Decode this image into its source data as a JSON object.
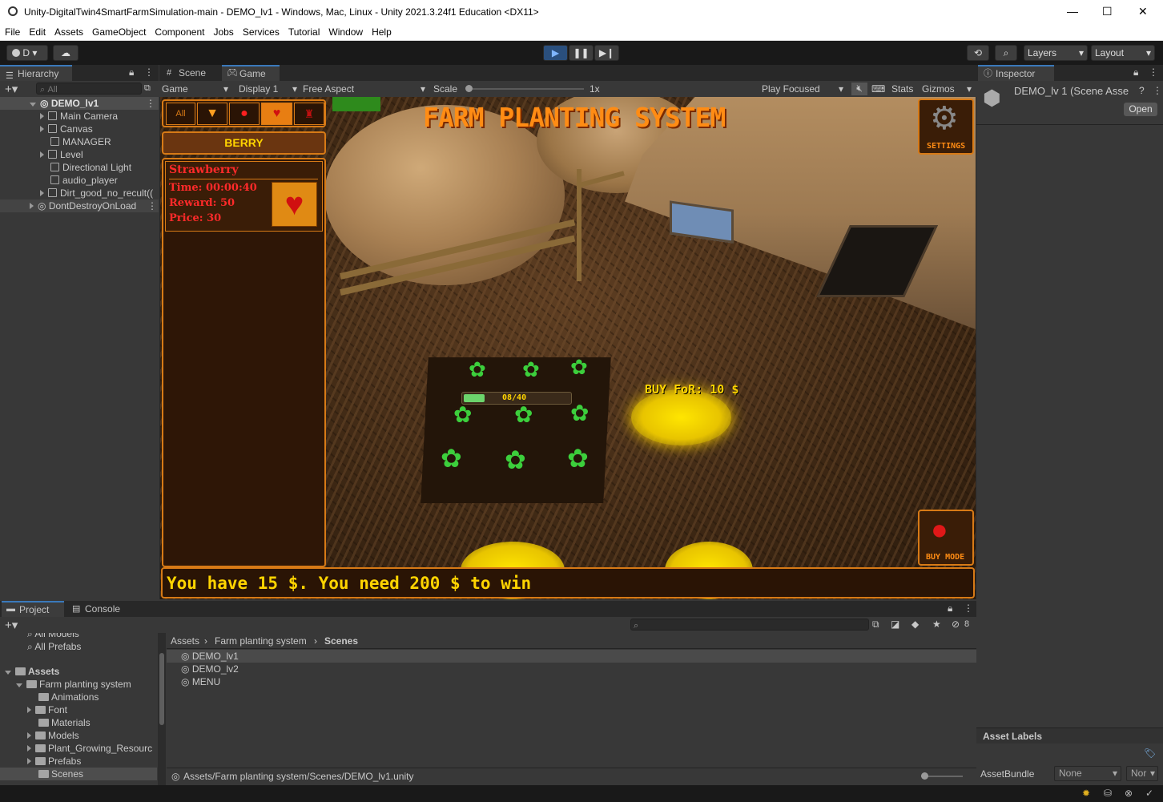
{
  "window": {
    "title": "Unity-DigitalTwin4SmartFarmSimulation-main - DEMO_lv1 - Windows, Mac, Linux - Unity 2021.3.24f1 Education <DX11>",
    "minimize": "—",
    "maximize": "☐",
    "close": "✕"
  },
  "menu": [
    "File",
    "Edit",
    "Assets",
    "GameObject",
    "Component",
    "Jobs",
    "Services",
    "Tutorial",
    "Window",
    "Help"
  ],
  "toolbar": {
    "account": "D",
    "layers": "Layers",
    "layout": "Layout"
  },
  "hierarchy": {
    "tab": "Hierarchy",
    "search_placeholder": "All",
    "scene": "DEMO_lv1",
    "items": [
      "Main Camera",
      "Canvas",
      "MANAGER",
      "Level",
      "Directional Light",
      "audio_player",
      "Dirt_good_no_recult(("
    ],
    "ddol": "DontDestroyOnLoad"
  },
  "game": {
    "tab_scene": "Scene",
    "tab_game": "Game",
    "mode": "Game",
    "display": "Display 1",
    "aspect": "Free Aspect",
    "scale_label": "Scale",
    "scale_value": "1x",
    "play_focused": "Play Focused",
    "stats": "Stats",
    "gizmos": "Gizmos"
  },
  "gameui": {
    "title": "FARM PLANTING SYSTEM",
    "filter_all": "All",
    "category": "BERRY",
    "item_name": "Strawberry",
    "item_time": "Time: 00:00:40",
    "item_reward": "Reward: 50",
    "item_price": "Price: 30",
    "settings": "SETTINGS",
    "buy_mode": "BUY MODE",
    "buy_for": "BUY FoR: 10 $",
    "progress": "08/40",
    "progress_value": 0.2,
    "message": "You have 15 $. You need 200 $ to win"
  },
  "inspector": {
    "tab": "Inspector",
    "object": "DEMO_lv 1 (Scene Asse",
    "open": "Open",
    "asset_labels": "Asset Labels",
    "asset_bundle": "AssetBundle",
    "bundle_value": "None",
    "variant_value": "Nor"
  },
  "project": {
    "tab_project": "Project",
    "tab_console": "Console",
    "hidden_count": "8",
    "favorites": [
      "All Models",
      "All Prefabs"
    ],
    "assets_root": "Assets",
    "tree_parent": "Farm planting system",
    "tree_children": [
      "Animations",
      "Font",
      "Materials",
      "Models",
      "Plant_Growing_Resourc",
      "Prefabs",
      "Scenes"
    ],
    "breadcrumb": [
      "Assets",
      "Farm planting system",
      "Scenes"
    ],
    "files": [
      "DEMO_lv1",
      "DEMO_lv2",
      "MENU"
    ],
    "path": "Assets/Farm planting system/Scenes/DEMO_lv1.unity"
  },
  "colors": {
    "accent": "#3a79bb",
    "ui_orange": "#d77a16",
    "ui_yellow": "#ffd400",
    "ui_red": "#ff2a2a"
  }
}
